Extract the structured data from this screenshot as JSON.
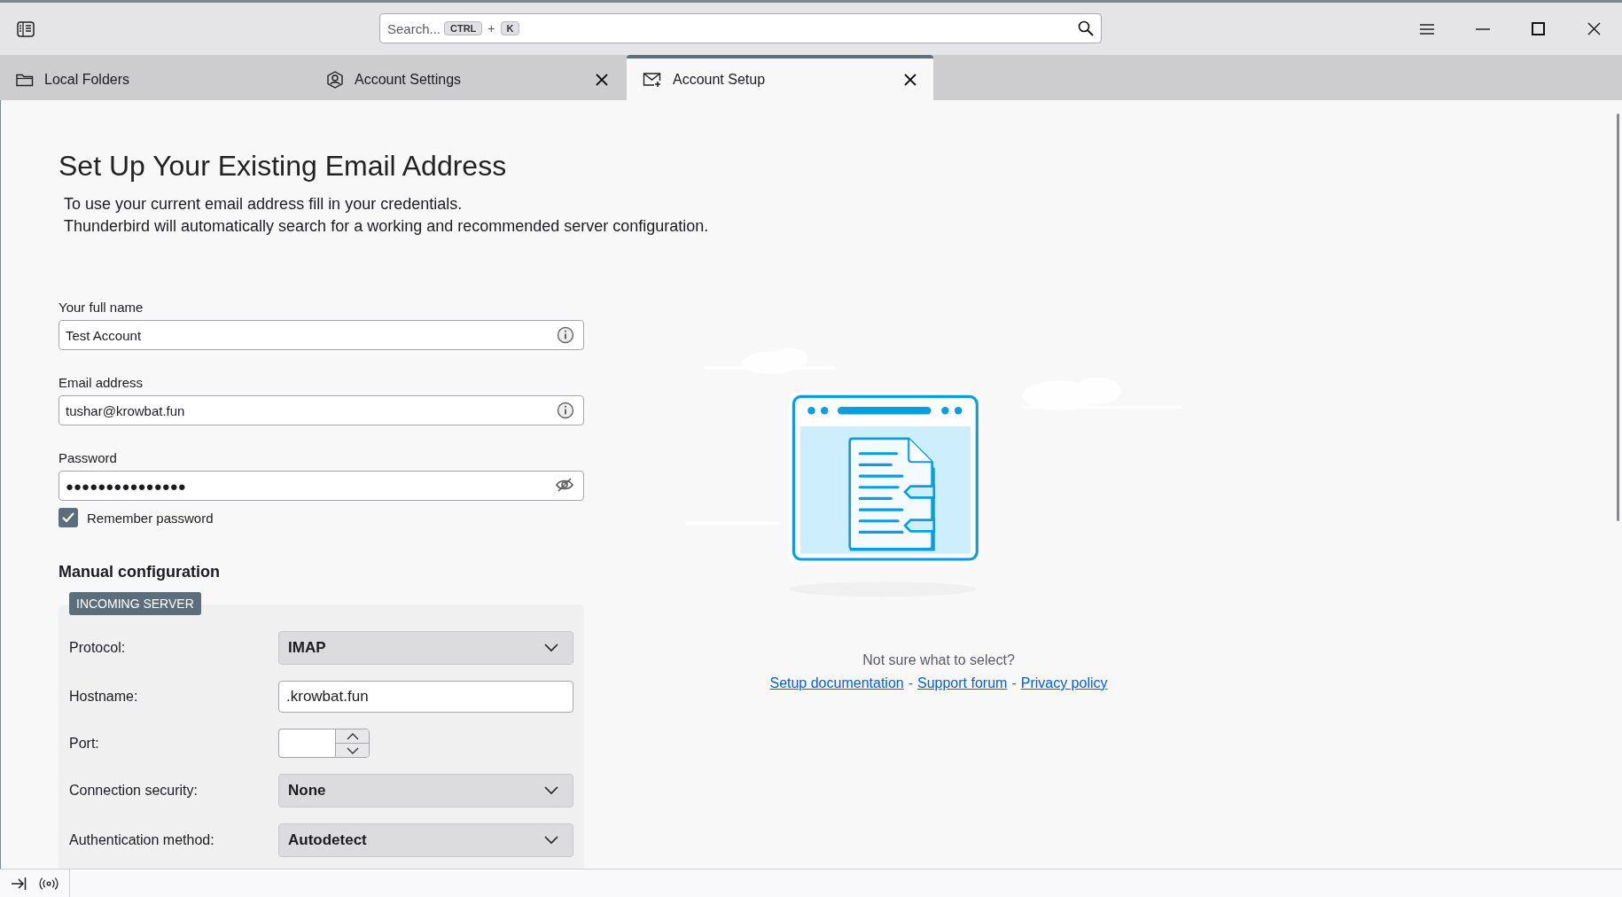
{
  "window": {
    "search": {
      "placeholder": "Search...",
      "shortcut": [
        "CTRL",
        "K"
      ],
      "shortcut_joiner": "+"
    }
  },
  "tabs": [
    {
      "label": "Local Folders",
      "selected": false,
      "closable": false
    },
    {
      "label": "Account Settings",
      "selected": false,
      "closable": true
    },
    {
      "label": "Account Setup",
      "selected": true,
      "closable": true
    }
  ],
  "page": {
    "title": "Set Up Your Existing Email Address",
    "description": [
      "To use your current email address fill in your credentials.",
      "Thunderbird will automatically search for a working and recommended server configuration."
    ]
  },
  "fields": [
    {
      "label": "Your full name",
      "value": "Test Account",
      "kind": "info"
    },
    {
      "label": "Email address",
      "value": "tushar@krowbat.fun",
      "kind": "info"
    },
    {
      "label": "Password",
      "value": "●●●●●●●●●●●●●●●",
      "kind": "password"
    }
  ],
  "remember_password": {
    "label": "Remember password",
    "checked": true
  },
  "manual_configuration": {
    "title": "Manual configuration",
    "section": "INCOMING SERVER",
    "rows": [
      {
        "label": "Protocol:",
        "kind": "select",
        "value": "IMAP"
      },
      {
        "label": "Hostname:",
        "kind": "text",
        "value": ".krowbat.fun"
      },
      {
        "label": "Port:",
        "kind": "number"
      },
      {
        "label": "Connection security:",
        "kind": "select",
        "value": "None"
      },
      {
        "label": "Authentication method:",
        "kind": "select",
        "value": "Autodetect"
      }
    ]
  },
  "help": {
    "question": "Not sure what to select?",
    "links": [
      "Setup documentation",
      "Support forum",
      "Privacy policy"
    ],
    "separators": [
      "-",
      "-"
    ]
  }
}
